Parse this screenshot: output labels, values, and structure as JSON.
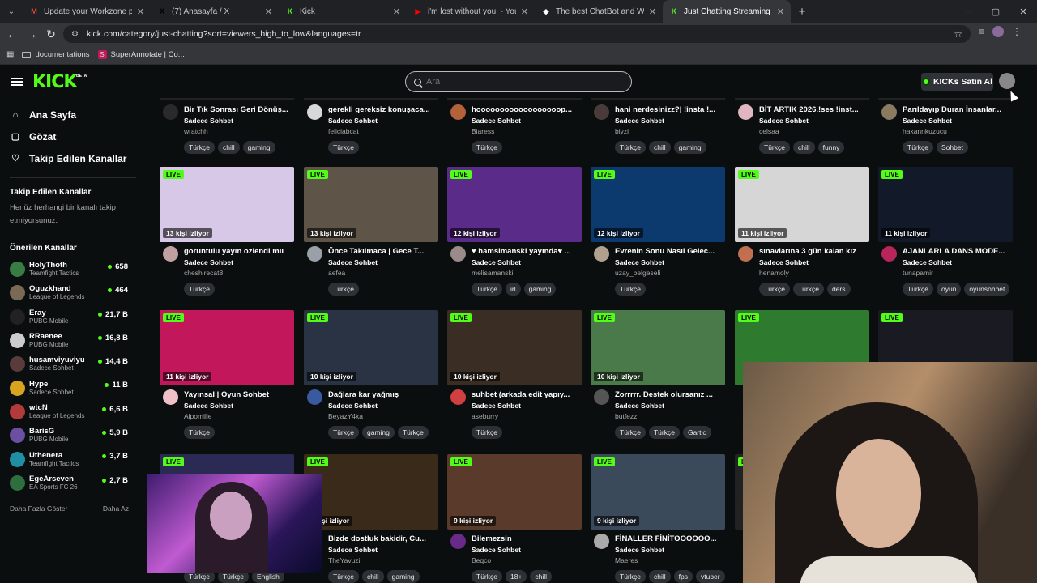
{
  "browser": {
    "tabs": [
      {
        "title": "Update your Workzone profile |",
        "favicon": "gmail-icon",
        "color": "#ea4335",
        "glyph": "M"
      },
      {
        "title": "(7) Anasayfa / X",
        "favicon": "x-icon",
        "color": "#000000",
        "glyph": "X"
      },
      {
        "title": "Kick",
        "favicon": "kick-icon",
        "color": "#53fc18",
        "glyph": "K"
      },
      {
        "title": "i'm lost without you. - YouT",
        "favicon": "youtube-icon",
        "color": "#ff0000",
        "glyph": "▶"
      },
      {
        "title": "The best ChatBot and Widgets",
        "favicon": "diamond-icon",
        "color": "#ffffff",
        "glyph": "◆"
      },
      {
        "title": "Just Chatting Streaming - Live S",
        "favicon": "kick-icon",
        "color": "#53fc18",
        "glyph": "K"
      }
    ],
    "url": "kick.com/category/just-chatting?sort=viewers_high_to_low&languages=tr",
    "bookmarks": [
      "documentations",
      "SuperAnnotate | Co..."
    ]
  },
  "header": {
    "logo": "KICK",
    "beta": "BETA",
    "search_placeholder": "Ara",
    "kicks_button": "KICKs Satın Al"
  },
  "sidebar": {
    "nav": [
      {
        "label": "Ana Sayfa",
        "icon": "home-icon",
        "glyph": "⌂"
      },
      {
        "label": "Gözat",
        "icon": "browse-icon",
        "glyph": "▢"
      },
      {
        "label": "Takip Edilen Kanallar",
        "icon": "heart-icon",
        "glyph": "♡"
      }
    ],
    "followed_heading": "Takip Edilen Kanallar",
    "followed_empty": "Henüz herhangi bir kanalı takip etmiyorsunuz.",
    "recommended_heading": "Önerilen Kanallar",
    "channels": [
      {
        "name": "HolyThoth",
        "category": "Teamfight Tactics",
        "viewers": "658",
        "color": "#3a7d44"
      },
      {
        "name": "Oguzkhand",
        "category": "League of Legends",
        "viewers": "464",
        "color": "#7a6a55"
      },
      {
        "name": "Eray",
        "category": "PUBG Mobile",
        "viewers": "21,7 B",
        "color": "#222222"
      },
      {
        "name": "RRaenee",
        "category": "PUBG Mobile",
        "viewers": "16,8 B",
        "color": "#cccccc"
      },
      {
        "name": "husamviyuviyu",
        "category": "Sadece Sohbet",
        "viewers": "14,4 B",
        "color": "#5a3b3b"
      },
      {
        "name": "Hype",
        "category": "Sadece Sohbet",
        "viewers": "11 B",
        "color": "#d9a320"
      },
      {
        "name": "wtcN",
        "category": "League of Legends",
        "viewers": "6,6 B",
        "color": "#b23a3a"
      },
      {
        "name": "BarisG",
        "category": "PUBG Mobile",
        "viewers": "5,9 B",
        "color": "#6b4fa0"
      },
      {
        "name": "Uthenera",
        "category": "Teamfight Tactics",
        "viewers": "3,7 B",
        "color": "#1f8fa6"
      },
      {
        "name": "EgeArseven",
        "category": "EA Sports FC 26",
        "viewers": "2,7 B",
        "color": "#2f6f3f"
      }
    ],
    "show_more": "Daha Fazla Göster",
    "show_less": "Daha Az"
  },
  "streams": {
    "live_label": "LIVE",
    "rows": [
      [
        {
          "title": "Bir Tık Sonrası Geri Dönüş...",
          "category": "Sadece Sohbet",
          "channel": "wratchh",
          "tags": [
            "Türkçe",
            "chill",
            "gaming"
          ],
          "viewers": "",
          "thumb": "#222222",
          "avatar": "#2a2a2a"
        },
        {
          "title": "gerekli gereksiz konuşaca...",
          "category": "Sadece Sohbet",
          "channel": "feliciabcat",
          "tags": [
            "Türkçe"
          ],
          "viewers": "",
          "thumb": "#222222",
          "avatar": "#d8d8d8"
        },
        {
          "title": "hoooooooooooooooooop...",
          "category": "Sadece Sohbet",
          "channel": "Biaress",
          "tags": [
            "Türkçe"
          ],
          "viewers": "",
          "thumb": "#222222",
          "avatar": "#b4623a"
        },
        {
          "title": "hani nerdesinizz?| !insta !...",
          "category": "Sadece Sohbet",
          "channel": "biyzi",
          "tags": [
            "Türkçe",
            "chill",
            "gaming"
          ],
          "viewers": "",
          "thumb": "#222222",
          "avatar": "#4a3b3b"
        },
        {
          "title": "BİT ARTIK 2026.!ses !inst...",
          "category": "Sadece Sohbet",
          "channel": "celsaa",
          "tags": [
            "Türkçe",
            "chill",
            "funny"
          ],
          "viewers": "",
          "thumb": "#222222",
          "avatar": "#e0b6c0"
        },
        {
          "title": "Parıldayıp Duran İnsanlar...",
          "category": "Sadece Sohbet",
          "channel": "hakannkuzucu",
          "tags": [
            "Türkçe",
            "Sohbet"
          ],
          "viewers": "",
          "thumb": "#222222",
          "avatar": "#8a7a60"
        }
      ],
      [
        {
          "title": "goruntulu yayın ozlendi mıı",
          "category": "Sadece Sohbet",
          "channel": "cheshirecat8",
          "tags": [
            "Türkçe"
          ],
          "viewers": "13 kişi izliyor",
          "thumb": "#d7c8e8",
          "avatar": "#c0a0a0"
        },
        {
          "title": "Önce Takılmaca | Gece T...",
          "category": "Sadece Sohbet",
          "channel": "aefea",
          "tags": [
            "Türkçe"
          ],
          "viewers": "13 kişi izliyor",
          "thumb": "#5e5448",
          "avatar": "#9aa0a8"
        },
        {
          "title": "♥ hamsimanski yayında♥ ...",
          "category": "Sadece Sohbet",
          "channel": "melisamanski",
          "tags": [
            "Türkçe",
            "irl",
            "gaming"
          ],
          "viewers": "12 kişi izliyor",
          "thumb": "#5b2b8a",
          "avatar": "#9a8a8a"
        },
        {
          "title": "Evrenin Sonu Nasıl Gelec...",
          "category": "Sadece Sohbet",
          "channel": "uzay_belgeseli",
          "tags": [
            "Türkçe"
          ],
          "viewers": "12 kişi izliyor",
          "thumb": "#0c3a6e",
          "avatar": "#b0a090"
        },
        {
          "title": "sınavlarına 3 gün kalan kız",
          "category": "Sadece Sohbet",
          "channel": "henamoly",
          "tags": [
            "Türkçe",
            "Türkçe",
            "ders"
          ],
          "viewers": "11 kişi izliyor",
          "thumb": "#d6d6d6",
          "avatar": "#c07050"
        },
        {
          "title": "AJANLARLA DANS MODE...",
          "category": "Sadece Sohbet",
          "channel": "tunapamir",
          "tags": [
            "Türkçe",
            "oyun",
            "oyunsohbet"
          ],
          "viewers": "11 kişi izliyor",
          "thumb": "#121a2a",
          "avatar": "#b7255a"
        }
      ],
      [
        {
          "title": "Yayınsal | Oyun Sohbet",
          "category": "Sadece Sohbet",
          "channel": "Alpomille",
          "tags": [
            "Türkçe"
          ],
          "viewers": "11 kişi izliyor",
          "thumb": "#c2185b",
          "avatar": "#f0c0c8"
        },
        {
          "title": "Dağlara kar yağmış",
          "category": "Sadece Sohbet",
          "channel": "BeyazY4ka",
          "tags": [
            "Türkçe",
            "gaming",
            "Türkçe"
          ],
          "viewers": "10 kişi izliyor",
          "thumb": "#2a3344",
          "avatar": "#3a5aa0"
        },
        {
          "title": "suhbet (arkada edit yapıy...",
          "category": "Sadece Sohbet",
          "channel": "aseburry",
          "tags": [
            "Türkçe"
          ],
          "viewers": "10 kişi izliyor",
          "thumb": "#3a2e24",
          "avatar": "#d04040"
        },
        {
          "title": "Zorrrrr. Destek olursanız ...",
          "category": "Sadece Sohbet",
          "channel": "butfezz",
          "tags": [
            "Türkçe",
            "Türkçe",
            "Gartic"
          ],
          "viewers": "10 kişi izliyor",
          "thumb": "#4a7a4a",
          "avatar": "#555555"
        },
        {
          "title": "",
          "category": "",
          "channel": "",
          "tags": [],
          "viewers": "",
          "thumb": "#2e7a2e",
          "avatar": "#444444"
        },
        {
          "title": "",
          "category": "",
          "channel": "",
          "tags": [],
          "viewers": "",
          "thumb": "#1a1a22",
          "avatar": "#444444"
        }
      ],
      [
        {
          "title": "",
          "category": "",
          "channel": "",
          "tags": [
            "Türkçe",
            "Türkçe",
            "English"
          ],
          "viewers": "",
          "thumb": "#2a2a55",
          "avatar": "#444444"
        },
        {
          "title": "Bizde dostluk bakidir, Cu...",
          "category": "Sadece Sohbet",
          "channel": "TheYavuzi",
          "tags": [
            "Türkçe",
            "chill",
            "gaming"
          ],
          "viewers": "9 kişi izliyor",
          "thumb": "#3a2a1a",
          "avatar": "#444444"
        },
        {
          "title": "Bilemezsin",
          "category": "Sadece Sohbet",
          "channel": "Beqco",
          "tags": [
            "Türkçe",
            "18+",
            "chill"
          ],
          "viewers": "9 kişi izliyor",
          "thumb": "#5a3a2a",
          "avatar": "#6a2a8a"
        },
        {
          "title": "FİNALLER FİNİTOOOOOO...",
          "category": "Sadece Sohbet",
          "channel": "Maeres",
          "tags": [
            "Türkçe",
            "chill",
            "fps",
            "vtuber"
          ],
          "viewers": "9 kişi izliyor",
          "thumb": "#3a4a5a",
          "avatar": "#aaaaaa"
        },
        {
          "title": "",
          "category": "",
          "channel": "",
          "tags": [],
          "viewers": "",
          "thumb": "#222222",
          "avatar": "#444444"
        },
        {
          "title": "",
          "category": "",
          "channel": "",
          "tags": [],
          "viewers": "",
          "thumb": "#222222",
          "avatar": "#444444"
        }
      ]
    ]
  }
}
